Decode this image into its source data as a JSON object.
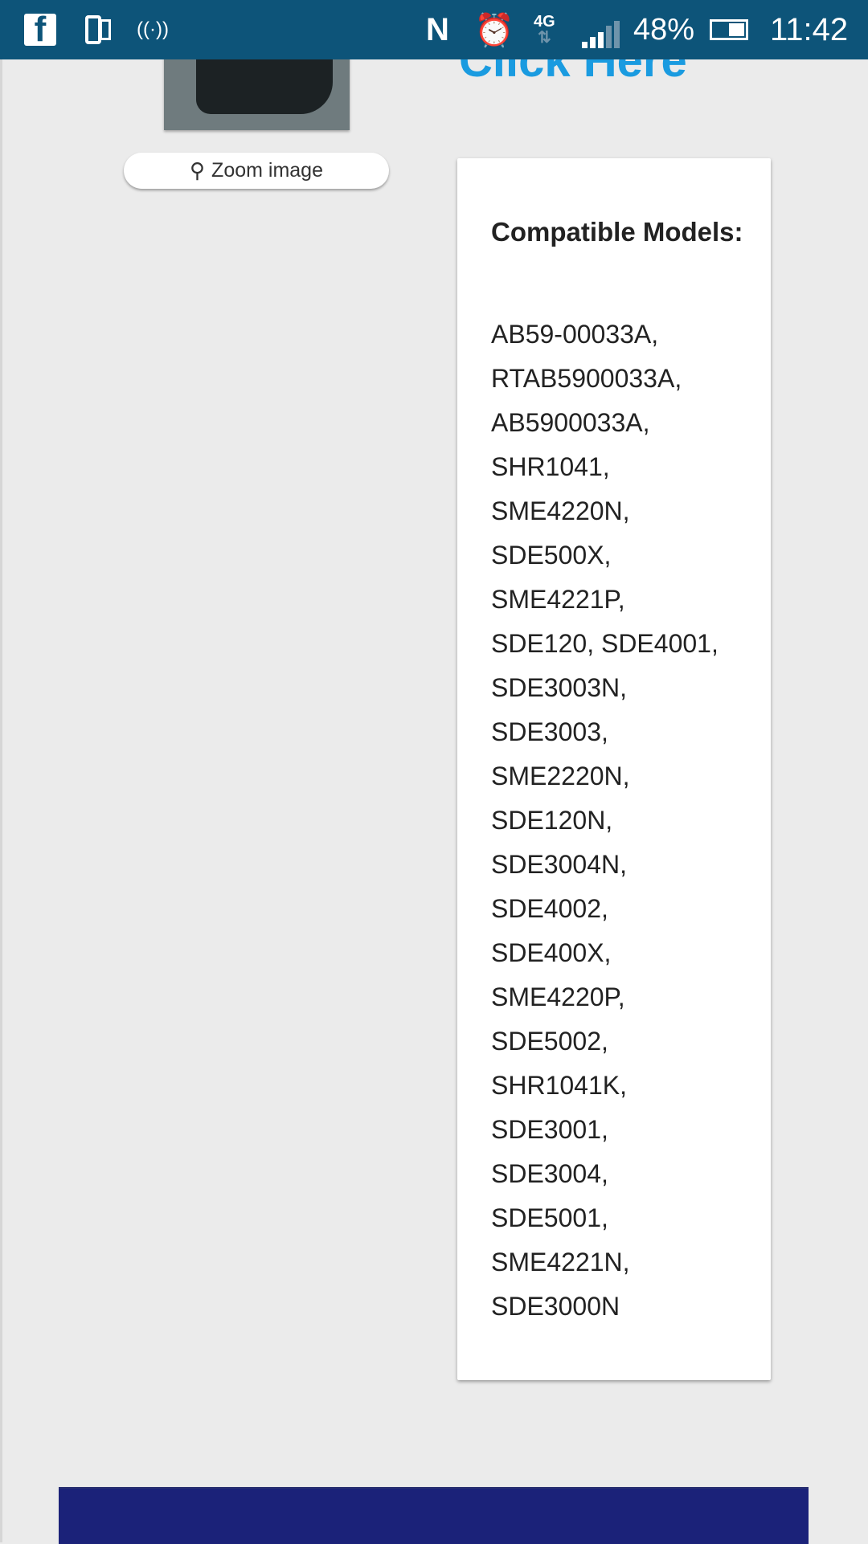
{
  "status_bar": {
    "battery_percent": "48%",
    "battery_level": 48,
    "time": "11:42",
    "network": "4G",
    "icons": [
      "facebook-icon",
      "device-icon",
      "hotspot-icon",
      "nfc-icon",
      "alarm-icon",
      "4g-data-icon",
      "signal-icon",
      "battery-icon"
    ],
    "background": "#0d5479"
  },
  "product": {
    "zoom_label": "Zoom image",
    "link_text": "Click Here",
    "link_color": "#1a9be0"
  },
  "compatible": {
    "title": "Compatible Models:",
    "lines": [
      "AB59-00033A,",
      "RTAB5900033A,",
      "AB5900033A,",
      "SHR1041,",
      "SME4220N,",
      "SDE500X,",
      "SME4221P,",
      "SDE120, SDE4001,",
      "SDE3003N,",
      "SDE3003,",
      "SME2220N,",
      "SDE120N,",
      "SDE3004N,",
      "SDE4002,",
      "SDE400X,",
      "SME4220P,",
      "SDE5002,",
      "SHR1041K,",
      "SDE3001,",
      "SDE3004,",
      "SDE5001,",
      "SME4221N,",
      "SDE3000N"
    ]
  },
  "footer": {
    "color": "#1b2279"
  }
}
